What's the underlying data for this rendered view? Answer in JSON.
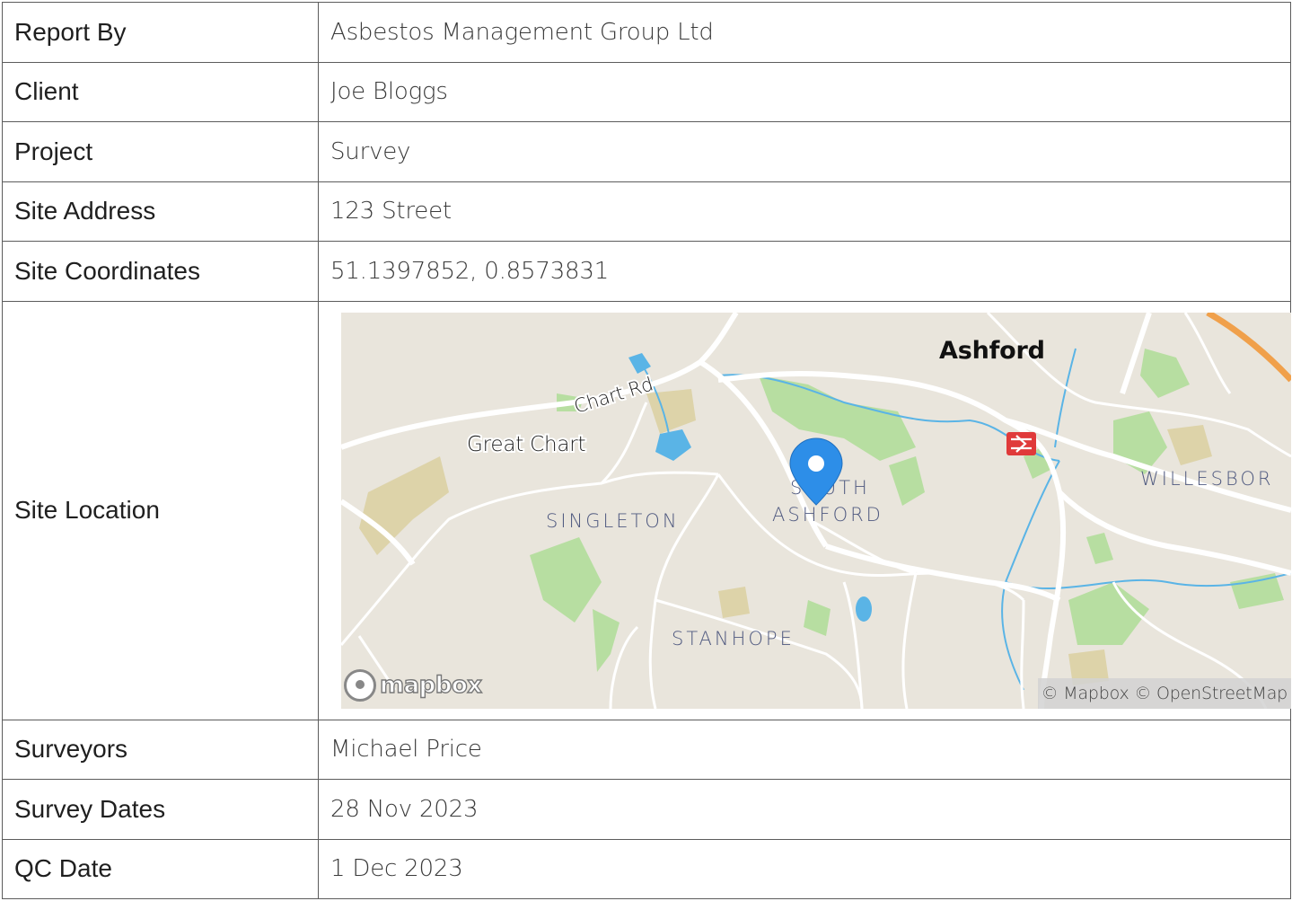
{
  "rows_top": [
    {
      "label": "Report By",
      "value": "Asbestos Management Group Ltd"
    },
    {
      "label": "Client",
      "value": "Joe Bloggs"
    },
    {
      "label": "Project",
      "value": "Survey"
    },
    {
      "label": "Site Address",
      "value": "123 Street"
    },
    {
      "label": "Site Coordinates",
      "value": "51.1397852, 0.8573831"
    }
  ],
  "site_location": {
    "label": "Site Location",
    "map": {
      "places": [
        "Ashford",
        "Great Chart",
        "Chart Rd",
        "SINGLETON",
        "SOUTH",
        "ASHFORD",
        "STANHOPE",
        "WILLESBOR"
      ],
      "marker_icon": "map-pin-icon",
      "rail_icon": "railway-station-icon",
      "logo_text": "mapbox",
      "attribution": "© Mapbox © OpenStreetMap",
      "colors": {
        "land": "#e9e5dc",
        "park": "#b7dea1",
        "water": "#5ab4e6",
        "road": "#ffffff",
        "motorway": "#f0a04b",
        "marker": "#2d8ee8"
      }
    }
  },
  "rows_bottom": [
    {
      "label": "Surveyors",
      "value": "Michael Price"
    },
    {
      "label": "Survey Dates",
      "value": "28 Nov 2023"
    },
    {
      "label": "QC Date",
      "value": "1 Dec 2023"
    }
  ]
}
